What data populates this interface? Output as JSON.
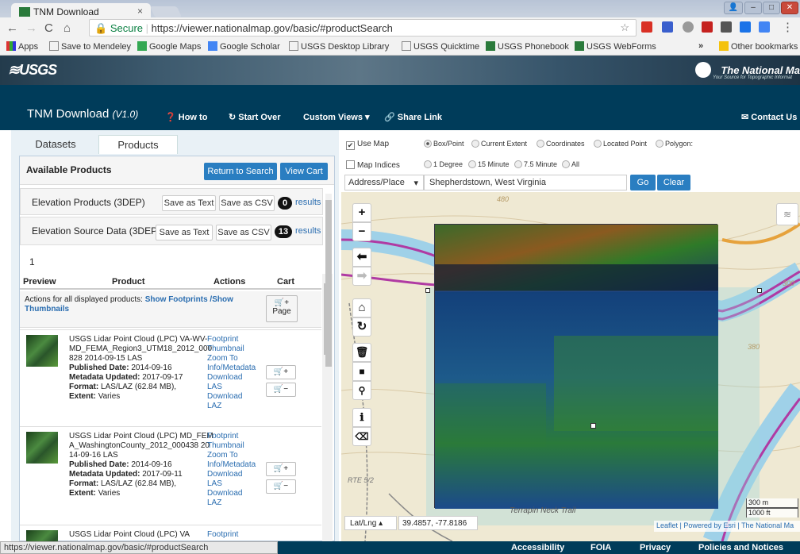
{
  "browser": {
    "tab_title": "TNM Download",
    "tab_close": "×",
    "url_secure": "Secure",
    "url": "https://viewer.nationalmap.gov/basic/#productSearch",
    "bookmarks": [
      "Apps",
      "Save to Mendeley",
      "Google Maps",
      "Google Scholar",
      "USGS Desktop Library",
      "USGS Quicktime",
      "USGS Phonebook",
      "USGS WebForms"
    ],
    "other_bookmarks": "Other bookmarks",
    "overflow": "»",
    "status_url": "https://viewer.nationalmap.gov/basic/#productSearch"
  },
  "header": {
    "usgs_logo": "≋USGS",
    "tnm_title": "The National Ma",
    "tnm_sub": "Your Source for Topographic Informat"
  },
  "navbar": {
    "title": "TNM Download",
    "version": "(V1.0)",
    "how_to": "How to",
    "start_over": "Start Over",
    "custom_views": "Custom Views",
    "share_link": "Share Link",
    "contact": "Contact Us"
  },
  "left": {
    "tab_datasets": "Datasets",
    "tab_products": "Products",
    "available_products": "Available Products",
    "return_btn": "Return to Search",
    "view_cart_btn": "View Cart",
    "groups": [
      {
        "name": "Elevation Products (3DEP)",
        "save_text": "Save as Text",
        "save_csv": "Save as CSV",
        "count": "0",
        "results": "results"
      },
      {
        "name": "Elevation Source Data (3DEP)",
        "save_text": "Save as Text",
        "save_csv": "Save as CSV",
        "count": "13",
        "results": "results"
      }
    ],
    "page_number": "1",
    "columns": [
      "Preview",
      "Product",
      "Actions",
      "Cart"
    ],
    "all_actions_prefix": "Actions for all displayed products:",
    "show_footprints": "Show Footprints",
    "show_thumbnails": "/Show Thumbnails",
    "cart_page": "Page",
    "rows": [
      {
        "title": "USGS Lidar Point Cloud (LPC) VA-WV-MD_FEMA_Region3_UTM18_2012_000828 2014-09-15 LAS",
        "published_label": "Published Date:",
        "published": "2014-09-16",
        "metadata_label": "Metadata Updated:",
        "metadata": "2017-09-17",
        "format_label": "Format:",
        "format": "LAS/LAZ (62.84 MB),",
        "extent_label": "Extent:",
        "extent": "Varies",
        "actions": [
          "Footprint",
          "Thumbnail",
          "Zoom To",
          "Info/Metadata",
          "Download LAS",
          "Download LAZ"
        ]
      },
      {
        "title": "USGS Lidar Point Cloud (LPC) MD_FEMA_WashingtonCounty_2012_000438 2014-09-16 LAS",
        "published_label": "Published Date:",
        "published": "2014-09-16",
        "metadata_label": "Metadata Updated:",
        "metadata": "2017-09-11",
        "format_label": "Format:",
        "format": "LAS/LAZ (62.84 MB),",
        "extent_label": "Extent:",
        "extent": "Varies",
        "actions": [
          "Footprint",
          "Thumbnail",
          "Zoom To",
          "Info/Metadata",
          "Download LAS",
          "Download LAZ"
        ]
      }
    ],
    "row3_title": "USGS Lidar Point Cloud (LPC) VA",
    "row3_action": "Footprint"
  },
  "mapctrl": {
    "use_map": "Use Map",
    "map_indices": "Map Indices",
    "options1": [
      "Box/Point",
      "Current Extent",
      "Coordinates",
      "Located Point",
      "Polygon:"
    ],
    "options2": [
      "1 Degree",
      "15 Minute",
      "7.5 Minute",
      "All"
    ],
    "search_type": "Address/Place",
    "search_value": "Shepherdstown, West Virginia",
    "go": "Go",
    "clear": "Clear"
  },
  "map": {
    "coord_label": "Lat/Lng ▴",
    "coords": "39.4857, -77.8186",
    "scale_m": "300 m",
    "scale_ft": "1000 ft",
    "attribution": "Leaflet | Powered by Esri | The National Ma",
    "road_label": "RTE 5/2",
    "trail_label": "Terrapin Neck Trail",
    "contours": [
      "480",
      "380",
      "300"
    ]
  },
  "footer": [
    "Accessibility",
    "FOIA",
    "Privacy",
    "Policies and Notices"
  ],
  "colors": {
    "accent": "#2a7ec1",
    "navbar": "#003c5a"
  }
}
